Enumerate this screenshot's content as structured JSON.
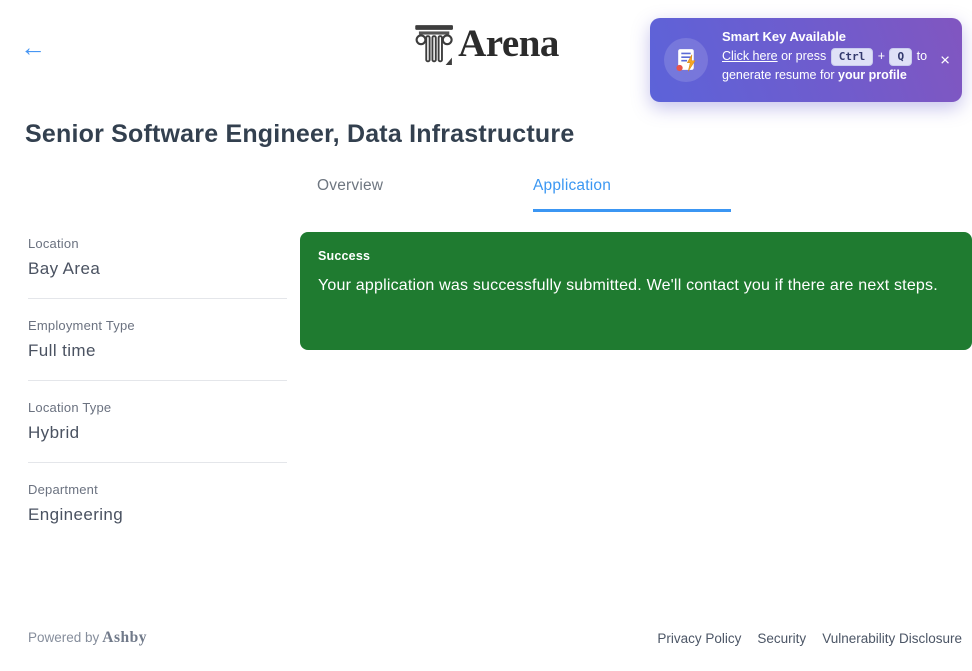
{
  "icons": {
    "back": "←",
    "close": "×",
    "arena_column": "column-capital",
    "toast_badge": "resume-lightning"
  },
  "header": {
    "logo_text": "Arena"
  },
  "toast": {
    "title": "Smart Key Available",
    "link_text": "Click here",
    "press_text": "or press",
    "key_ctrl": "Ctrl",
    "plus": "+",
    "key_q": "Q",
    "to_text": "to",
    "line2": "generate resume for",
    "line2_bold": "your profile"
  },
  "page": {
    "title": "Senior Software Engineer, Data Infrastructure"
  },
  "tabs": [
    {
      "label": "Overview",
      "active": false
    },
    {
      "label": "Application",
      "active": true
    }
  ],
  "details": [
    {
      "label": "Location",
      "value": "Bay Area"
    },
    {
      "label": "Employment Type",
      "value": "Full time"
    },
    {
      "label": "Location Type",
      "value": "Hybrid"
    },
    {
      "label": "Department",
      "value": "Engineering"
    }
  ],
  "banner": {
    "title": "Success",
    "message": "Your application was successfully submitted. We'll contact you if there are next steps."
  },
  "footer": {
    "powered_by": "Powered by",
    "brand": "Ashby",
    "links": [
      "Privacy Policy",
      "Security",
      "Vulnerability Disclosure"
    ]
  },
  "colors": {
    "accent_blue": "#3b97f2",
    "success_green": "#1f7b30",
    "toast_gradient_from": "#5c63d9",
    "toast_gradient_to": "#8156c0",
    "title_text": "#33404f",
    "muted_label": "#6b7280"
  }
}
